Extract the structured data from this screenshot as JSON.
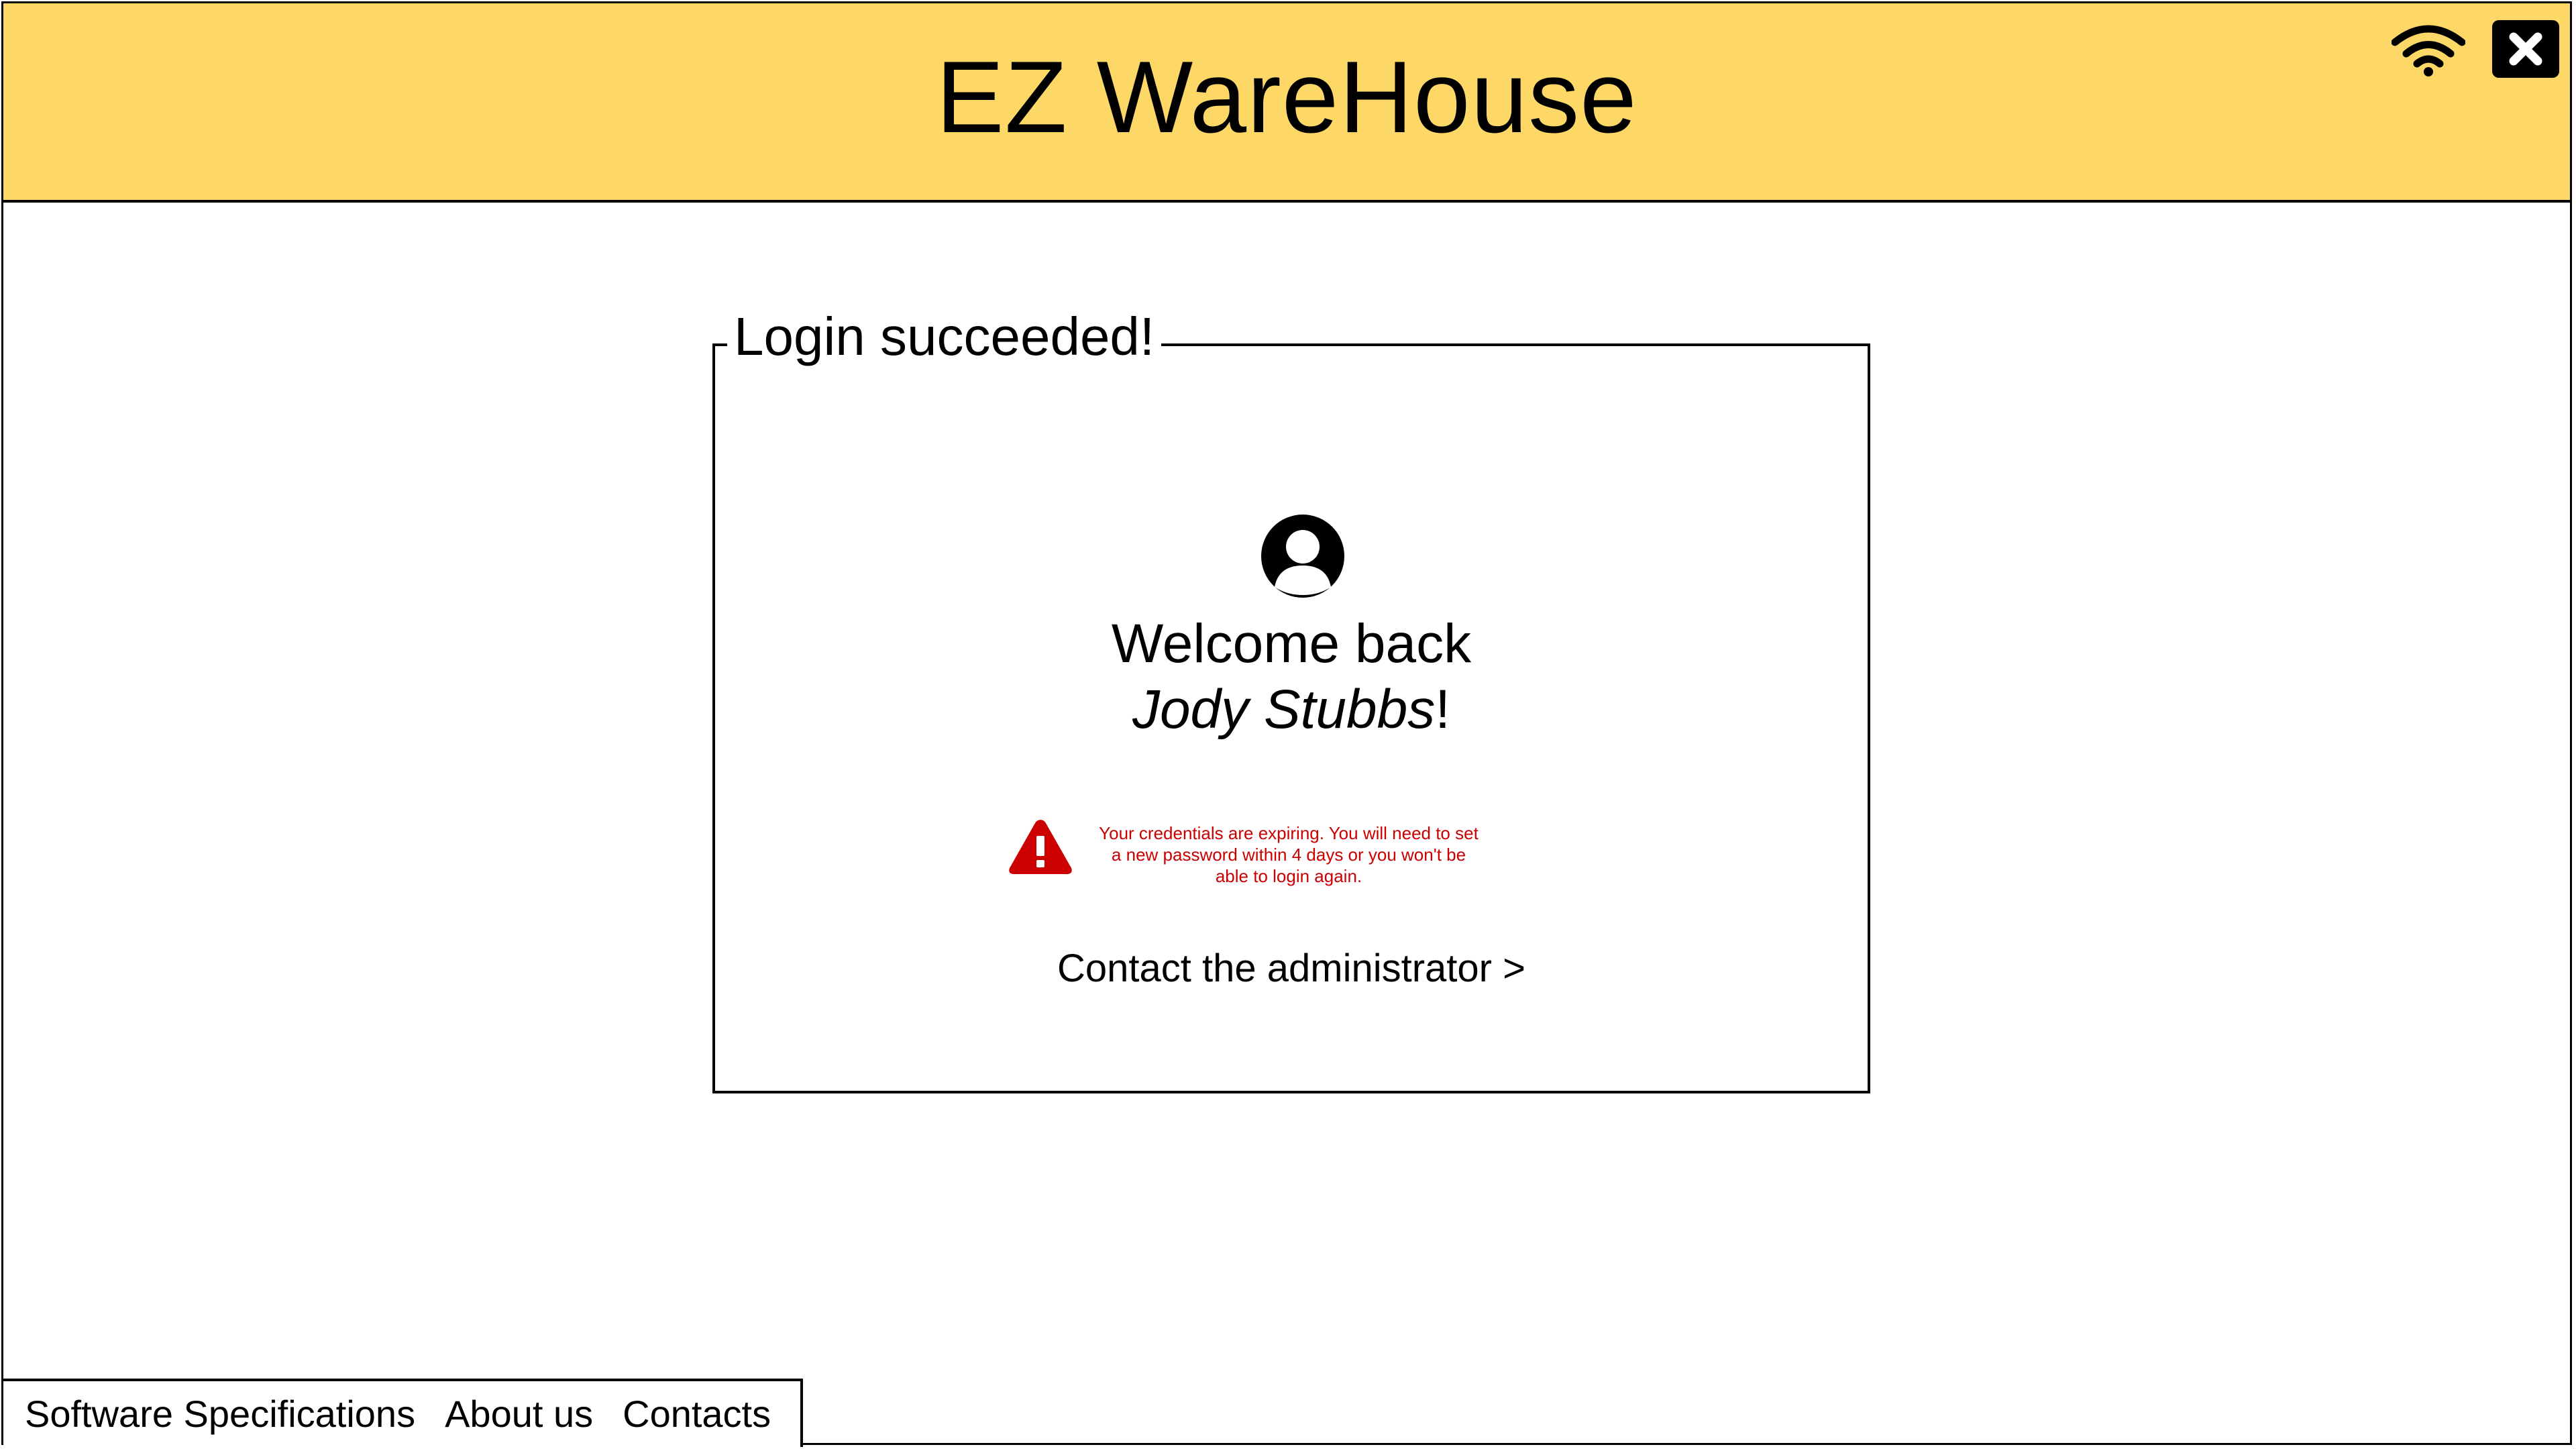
{
  "app": {
    "title": "EZ WareHouse"
  },
  "header_icons": {
    "wifi": "wifi-icon",
    "close": "close-icon"
  },
  "login_panel": {
    "legend": "Login succeeded!",
    "welcome_line1": "Welcome back",
    "user_name": "Jody Stubbs",
    "welcome_suffix": "!",
    "warning_text": "Your credentials are expiring. You will need to set a new password within 4 days or you won't be able to login again.",
    "contact_link": "Contact the administrator >"
  },
  "footer": {
    "links": [
      {
        "label": "Software Specifications"
      },
      {
        "label": "About us"
      },
      {
        "label": "Contacts"
      }
    ]
  },
  "colors": {
    "header_bg": "#fdd867",
    "warning": "#cc0000"
  }
}
